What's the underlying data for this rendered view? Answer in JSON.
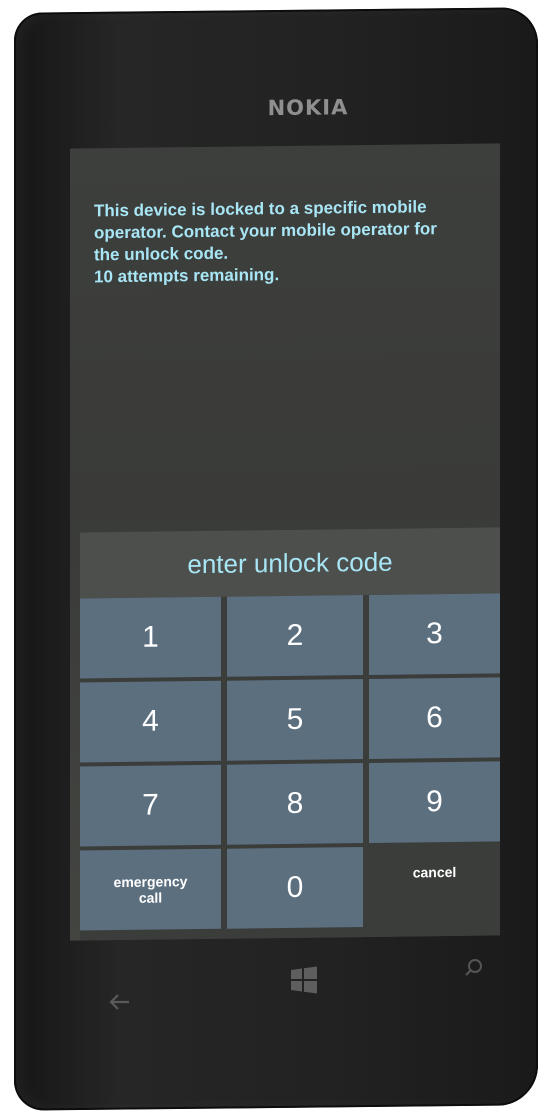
{
  "device": {
    "brand": "NOKIA"
  },
  "screen": {
    "message_lines": [
      "This device is locked to a specific mobile",
      "operator. Contact your mobile operator for",
      "the unlock code.",
      "10 attempts remaining."
    ],
    "code_label": "enter unlock code",
    "keys": {
      "k1": "1",
      "k2": "2",
      "k3": "3",
      "k4": "4",
      "k5": "5",
      "k6": "6",
      "k7": "7",
      "k8": "8",
      "k9": "9",
      "k0": "0",
      "emergency": "emergency\ncall",
      "cancel": "cancel"
    }
  },
  "navbar": {
    "icons": [
      "back-icon",
      "windows-icon",
      "search-icon"
    ]
  },
  "colors": {
    "text_accent": "#a8e6f5",
    "key_bg": "#5c6f7f",
    "screen_bg": "#3d3f3d"
  }
}
